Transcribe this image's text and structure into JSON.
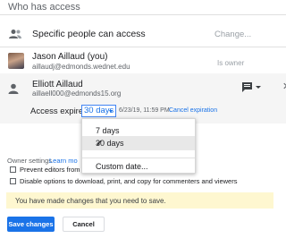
{
  "section_title": "Who has access",
  "general_access": {
    "label": "Specific people can access",
    "change_link": "Change..."
  },
  "people": [
    {
      "name": "Jason Aillaud (you)",
      "email": "aillaudj@edmonds.wednet.edu",
      "role": "Is owner"
    },
    {
      "name": "Elliott Aillaud",
      "email": "aillaell000@edmonds15.org",
      "expiry": {
        "label": "Access expires",
        "selected": "30 days",
        "date": "6/23/19, 11:59 PM",
        "cancel_link": "Cancel expiration"
      }
    }
  ],
  "dropdown": {
    "options": [
      "7 days",
      "30 days",
      "Custom date..."
    ],
    "selected_index": 1
  },
  "owner_settings": {
    "label": "Owner settings",
    "learn_more": "Learn mo",
    "options": [
      "Prevent editors from c",
      "Disable options to download, print, and copy for commenters and viewers"
    ]
  },
  "banner": "You have made changes that you need to save.",
  "buttons": {
    "save": "Save changes",
    "cancel": "Cancel"
  },
  "colors": {
    "accent": "#1a73e8",
    "banner_bg": "#fef7d0",
    "selected_row_bg": "#f5f5f5"
  }
}
